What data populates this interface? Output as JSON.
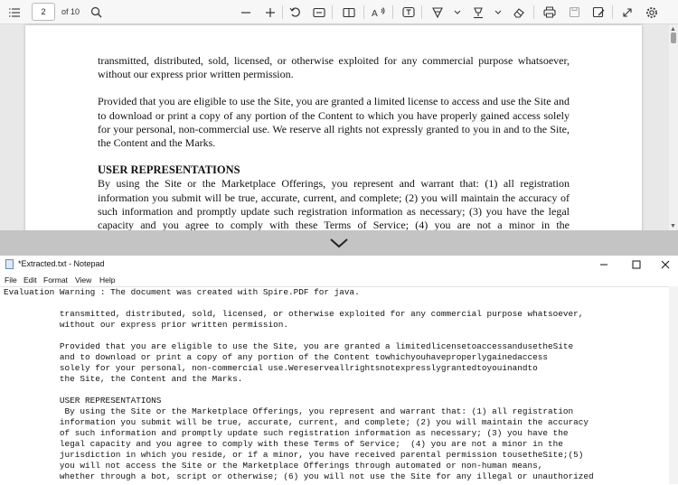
{
  "pdf_toolbar": {
    "page_number": "2",
    "page_total": "of 10"
  },
  "pdf_content": {
    "para1": "transmitted, distributed, sold, licensed, or otherwise exploited for any commercial purpose whatsoever, without our express prior written permission.",
    "para2": "Provided that you are eligible to use the Site, you are granted a limited license to access and use the Site and to download or print a copy of any portion of the Content to which you have properly gained access solely for your personal, non-commercial use. We reserve all rights not expressly granted to you in and to the Site, the Content and the Marks.",
    "heading": "USER REPRESENTATIONS",
    "para3": " By using the Site or the Marketplace Offerings, you represent and warrant that: (1) all registration information you submit will be true, accurate, current, and complete; (2) you will maintain the accuracy of such information and promptly update such registration information as necessary; (3) you have the legal capacity and you agree to comply with these Terms of Service; (4) you are not a minor in the"
  },
  "notepad": {
    "title": "*Extracted.txt - Notepad",
    "menu": [
      "File",
      "Edit",
      "Format",
      "View",
      "Help"
    ],
    "text": "Evaluation Warning : The document was created with Spire.PDF for java.\n\n           transmitted, distributed, sold, licensed, or otherwise exploited for any commercial purpose whatsoever,\n           without our express prior written permission.\n\n           Provided that you are eligible to use the Site, you are granted a limitedlicensetoaccessandusetheSite\n           and to download or print a copy of any portion of the Content towhichyouhaveproperlygainedaccess\n           solely for your personal, non-commercial use.Wereserveallrightsnotexpresslygrantedtoyouinandto\n           the Site, the Content and the Marks.\n\n           USER REPRESENTATIONS\n            By using the Site or the Marketplace Offerings, you represent and warrant that: (1) all registration\n           information you submit will be true, accurate, current, and complete; (2) you will maintain the accuracy\n           of such information and promptly update such registration information as necessary; (3) you have the\n           legal capacity and you agree to comply with these Terms of Service;  (4) you are not a minor in the\n           jurisdiction in which you reside, or if a minor, you have received parental permission tousetheSite;(5)\n           you will not access the Site or the Marketplace Offerings through automated or non-human means,\n           whether through a bot, script or otherwise; (6) you will not use the Site for any illegal or unauthorized"
  }
}
